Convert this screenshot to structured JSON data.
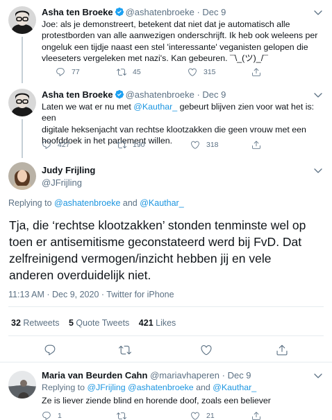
{
  "tweet1": {
    "display_name": "Asha ten Broeke",
    "handle": "@ashatenbroeke",
    "sep": "·",
    "date": "Dec 9",
    "line1": "Joe: als je demonstreert, betekent dat niet dat je automatisch alle",
    "line2": "protestborden van alle aanwezigen onderschrijft. Ik heb ook weleens per",
    "line3": "ongeluk een tijdje naast een stel 'interessante' veganisten gelopen die",
    "line4": "vleeseters vergeleken met nazi's. Kan gebeuren. ¯\\_(ツ)_/¯",
    "replies": "77",
    "retweets": "45",
    "likes": "315"
  },
  "tweet2": {
    "display_name": "Asha ten Broeke",
    "handle": "@ashatenbroeke",
    "sep": "·",
    "date": "Dec 9",
    "line1_pre": "Laten we wat er nu met ",
    "line1_mention": "@Kauthar_",
    "line1_post": " gebeurt blijven zien voor wat het is: een",
    "line2": "digitale heksenjacht van rechtse klootzakken die geen vrouw met een",
    "line3": "hoofddoek in het parlement willen.",
    "replies": "427",
    "retweets": "190",
    "likes": "318"
  },
  "main": {
    "display_name": "Judy Frijling",
    "handle": "@JFrijling",
    "replying_prefix": "Replying to ",
    "replying_mention1": "@ashatenbroeke",
    "replying_and": " and ",
    "replying_mention2": "@Kauthar_",
    "line1": "Tja, die ‘rechtse klootzakken’ stonden tenminste wel op",
    "line2": "toen er antisemitisme geconstateerd werd bij FvD. Dat",
    "line3": "zelfreinigend vermogen/inzicht hebben jij en vele",
    "line4": "anderen overduidelijk niet.",
    "timestamp": "11:13 AM · Dec 9, 2020 · ",
    "source": "Twitter for iPhone",
    "retweets_count": "32",
    "retweets_label": " Retweets",
    "quotes_count": "5",
    "quotes_label": " Quote Tweets",
    "likes_count": "421",
    "likes_label": " Likes"
  },
  "reply": {
    "display_name": "Maria van Beurden Cahn",
    "handle": "@mariavhaperen",
    "sep": "·",
    "date": "Dec 9",
    "replying_prefix": "Replying to ",
    "replying_mentions": "@JFrijling @ashatenbroeke",
    "replying_and": " and ",
    "replying_mention3": "@Kauthar_",
    "text": "Ze is liever ziende blind en horende doof, zoals een believer",
    "replies": "1",
    "retweets": "",
    "likes": "21"
  },
  "colors": {
    "link": "#1b95e0",
    "muted": "#5b7083",
    "text": "#0f1419",
    "divider": "#e6ecf0"
  }
}
